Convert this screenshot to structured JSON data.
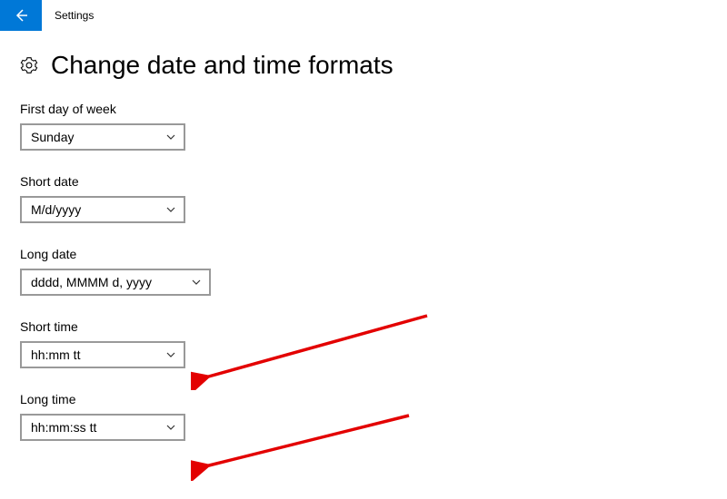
{
  "header": {
    "app_title": "Settings"
  },
  "page": {
    "heading": "Change date and time formats"
  },
  "fields": {
    "first_day_of_week": {
      "label": "First day of week",
      "value": "Sunday"
    },
    "short_date": {
      "label": "Short date",
      "value": "M/d/yyyy"
    },
    "long_date": {
      "label": "Long date",
      "value": "dddd, MMMM d, yyyy"
    },
    "short_time": {
      "label": "Short time",
      "value": "hh:mm tt"
    },
    "long_time": {
      "label": "Long time",
      "value": "hh:mm:ss tt"
    }
  }
}
